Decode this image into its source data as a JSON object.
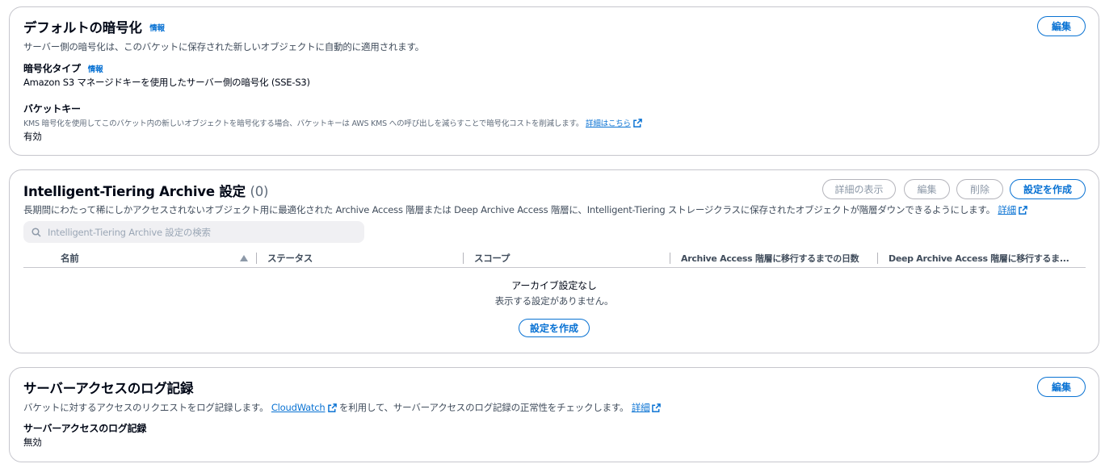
{
  "encryption": {
    "title": "デフォルトの暗号化",
    "info": "情報",
    "edit_label": "編集",
    "description": "サーバー側の暗号化は、このバケットに保存された新しいオブジェクトに自動的に適用されます。",
    "type_label": "暗号化タイプ",
    "type_info": "情報",
    "type_value": "Amazon S3 マネージドキーを使用したサーバー側の暗号化 (SSE-S3)",
    "bucket_key_label": "バケットキー",
    "bucket_key_desc": "KMS 暗号化を使用してこのバケット内の新しいオブジェクトを暗号化する場合、バケットキーは AWS KMS への呼び出しを減らすことで暗号化コストを削減します。",
    "bucket_key_link": "詳細はこちら",
    "bucket_key_value": "有効"
  },
  "tiering": {
    "title": "Intelligent-Tiering Archive 設定",
    "count": "(0)",
    "buttons": {
      "details": "詳細の表示",
      "edit": "編集",
      "delete": "削除",
      "create": "設定を作成"
    },
    "description": "長期間にわたって稀にしかアクセスされないオブジェクト用に最適化された Archive Access 階層または Deep Archive Access 階層に、Intelligent-Tiering ストレージクラスに保存されたオブジェクトが階層ダウンできるようにします。",
    "description_link": "詳細",
    "search_placeholder": "Intelligent-Tiering Archive 設定の検索",
    "columns": [
      "名前",
      "ステータス",
      "スコープ",
      "Archive Access 階層に移行するまでの日数",
      "Deep Archive Access 階層に移行するま..."
    ],
    "empty_title": "アーカイブ設定なし",
    "empty_desc": "表示する設定がありません。",
    "empty_create": "設定を作成"
  },
  "logging": {
    "title": "サーバーアクセスのログ記録",
    "edit_label": "編集",
    "desc_before": "バケットに対するアクセスのリクエストをログ記録します。",
    "desc_link": "CloudWatch",
    "desc_after": "を利用して、サーバーアクセスのログ記録の正常性をチェックします。",
    "desc_link2": "詳細",
    "field_label": "サーバーアクセスのログ記録",
    "field_value": "無効"
  },
  "colors": {
    "accent": "#0972d3",
    "text": "#000716",
    "border": "#c6c6cd",
    "disabled": "#8d99a8"
  }
}
